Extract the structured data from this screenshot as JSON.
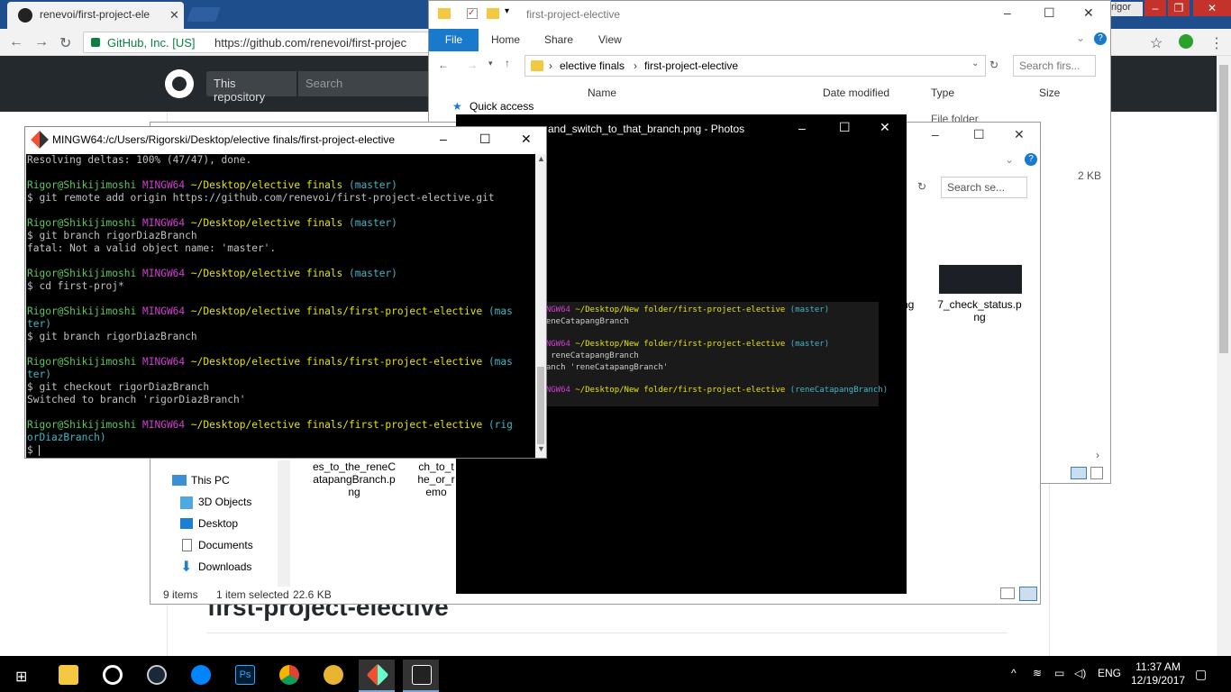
{
  "chrome": {
    "tab_title": "renevoi/first-project-ele",
    "security_label": "GitHub, Inc. [US]",
    "url": "https://github.com/renevoi/first-projec",
    "user_name": "rigor",
    "brand_color": "#1f4e8c"
  },
  "github": {
    "scope_label": "This repository",
    "search_placeholder": "Search",
    "repo_heading": "first-project-elective"
  },
  "explorer_back": {
    "title": "first-project-elective",
    "ribbon_tabs": [
      "File",
      "Home",
      "Share",
      "View"
    ],
    "breadcrumb": [
      "elective finals",
      "first-project-elective"
    ],
    "search_placeholder": "Search firs...",
    "quick_access": "Quick access",
    "columns": [
      "Name",
      "Date modified",
      "Type",
      "Size"
    ],
    "row_type": "File folder",
    "row_size": "2 KB"
  },
  "explorer_front": {
    "search_placeholder": "Search se...",
    "nav_items": [
      "This PC",
      "3D Objects",
      "Desktop",
      "Documents",
      "Downloads"
    ],
    "files": [
      {
        "name": "es_to_the_reneCatapangBranch.png"
      },
      {
        "name": "ch_to_the_or_remo"
      },
      {
        "name": "ng"
      },
      {
        "name": "7_check_status.png"
      }
    ],
    "status_items": "9 items",
    "status_selected": "1 item selected",
    "status_size": "22.6 KB"
  },
  "photos": {
    "title": "and_switch_to_that_branch.png - Photos",
    "img_lines": [
      {
        "a": "MINGW64",
        "b": " ~/Desktop/New folder/first-project-elective",
        "c": " (master)"
      },
      {
        "t": " reneCatapangBranch"
      },
      {
        "a": "MINGW64",
        "b": " ~/Desktop/New folder/first-project-elective",
        "c": " (master)"
      },
      {
        "t": "ut reneCatapangBranch"
      },
      {
        "t": "branch 'reneCatapangBranch'"
      },
      {
        "a": "MINGW64",
        "b": " ~/Desktop/New folder/first-project-elective",
        "c": " (reneCatapangBranch)"
      }
    ]
  },
  "terminal": {
    "title": "MINGW64:/c/Users/Rigorski/Desktop/elective finals/first-project-elective",
    "user": "Rigor@Shikijimoshi",
    "shell": "MINGW64",
    "lines": {
      "l1": "Resolving deltas: 100% (47/47), done.",
      "p1": " ~/Desktop/elective finals",
      "b1": " (master)",
      "c1": "$ git remote add origin https://github.com/renevoi/first-project-elective.git",
      "c2": "$ git branch rigorDiazBranch",
      "o2": "fatal: Not a valid object name: 'master'.",
      "c3": "$ cd first-proj*",
      "p4": " ~/Desktop/elective finals/first-project-elective",
      "b4a": " (mas",
      "b4b": "ter)",
      "c4": "$ git branch rigorDiazBranch",
      "c5": "$ git checkout rigorDiazBranch",
      "o5": "Switched to branch 'rigorDiazBranch'",
      "b6a": " (rig",
      "b6b": "orDiazBranch)",
      "c6": "$ "
    }
  },
  "taskbar": {
    "time": "11:37 AM",
    "date": "12/19/2017",
    "language": "ENG"
  }
}
